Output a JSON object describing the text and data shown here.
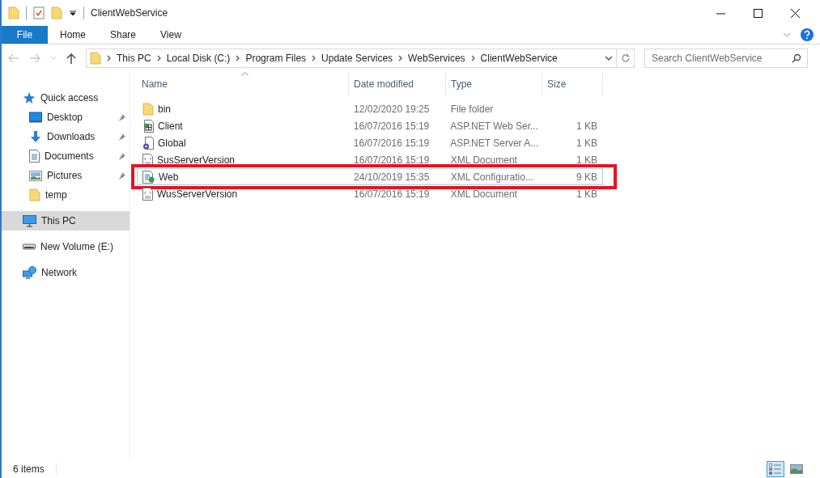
{
  "window": {
    "title": "ClientWebService"
  },
  "ribbon_tabs": [
    {
      "label": "File",
      "kind": "file"
    },
    {
      "label": "Home",
      "kind": "tab"
    },
    {
      "label": "Share",
      "kind": "tab"
    },
    {
      "label": "View",
      "kind": "tab"
    }
  ],
  "address": {
    "crumbs": [
      "This PC",
      "Local Disk (C:)",
      "Program Files",
      "Update Services",
      "WebServices",
      "ClientWebService"
    ]
  },
  "search": {
    "placeholder": "Search ClientWebService"
  },
  "sidebar": {
    "items": [
      {
        "label": "Quick access",
        "kind": "quick",
        "selected": false,
        "pinned": false,
        "children": [
          {
            "label": "Desktop",
            "kind": "desktop",
            "selected": false,
            "pinned": true
          },
          {
            "label": "Downloads",
            "kind": "downloads",
            "selected": false,
            "pinned": true
          },
          {
            "label": "Documents",
            "kind": "documents",
            "selected": false,
            "pinned": true
          },
          {
            "label": "Pictures",
            "kind": "pictures",
            "selected": false,
            "pinned": true
          },
          {
            "label": "temp",
            "kind": "folder",
            "selected": false,
            "pinned": false
          }
        ]
      },
      {
        "label": "This PC",
        "kind": "pc",
        "selected": true,
        "pinned": false
      },
      {
        "label": "New Volume (E:)",
        "kind": "drive",
        "selected": false,
        "pinned": false
      },
      {
        "label": "Network",
        "kind": "network",
        "selected": false,
        "pinned": false
      }
    ]
  },
  "table": {
    "columns": [
      "Name",
      "Date modified",
      "Type",
      "Size"
    ],
    "rows": [
      {
        "kind": "folder",
        "name": "bin",
        "date": "12/02/2020 19:25",
        "type": "File folder",
        "size": "",
        "focused": false,
        "highlighted": false
      },
      {
        "kind": "aspx",
        "name": "Client",
        "date": "16/07/2016 15:19",
        "type": "ASP.NET Web Ser...",
        "size": "1 KB",
        "focused": false,
        "highlighted": false
      },
      {
        "kind": "asax",
        "name": "Global",
        "date": "16/07/2016 15:19",
        "type": "ASP.NET Server A...",
        "size": "1 KB",
        "focused": false,
        "highlighted": false
      },
      {
        "kind": "xml",
        "name": "SusServerVersion",
        "date": "16/07/2016 15:19",
        "type": "XML Document",
        "size": "1 KB",
        "focused": false,
        "highlighted": false
      },
      {
        "kind": "config",
        "name": "Web",
        "date": "24/10/2019 15:35",
        "type": "XML Configuratio...",
        "size": "9 KB",
        "focused": true,
        "highlighted": true
      },
      {
        "kind": "xml",
        "name": "WusServerVersion",
        "date": "16/07/2016 15:19",
        "type": "XML Document",
        "size": "1 KB",
        "focused": false,
        "highlighted": false
      }
    ]
  },
  "status_bar": {
    "count": "6 items"
  },
  "view_buttons": [
    {
      "kind": "details",
      "selected": true
    },
    {
      "kind": "large",
      "selected": false
    }
  ]
}
